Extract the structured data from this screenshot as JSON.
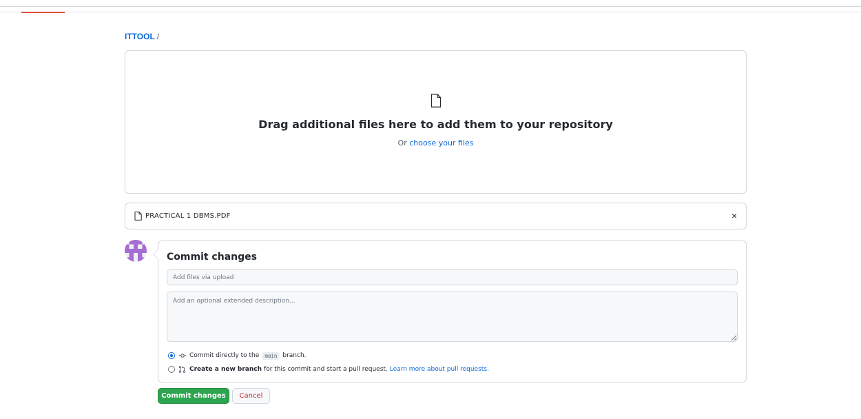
{
  "breadcrumb": {
    "repo": "ITTOOL",
    "separator": "/"
  },
  "dropzone": {
    "title": "Drag additional files here to add them to your repository",
    "sub_prefix": "Or",
    "sub_link": "choose your files",
    "icon": "file-icon"
  },
  "files": [
    {
      "name": "PRACTICAL 1 DBMS.PDF",
      "icon": "file-icon",
      "remove": "×"
    }
  ],
  "commit": {
    "title": "Commit changes",
    "summary_placeholder": "Add files via upload",
    "description_placeholder": "Add an optional extended description...",
    "option_direct": {
      "prefix": "Commit directly to the",
      "branch": "main",
      "suffix": "branch.",
      "selected": true
    },
    "option_new_branch": {
      "bold": "Create a new branch",
      "text": "for this commit and start a pull request.",
      "link": "Learn more about pull requests.",
      "selected": false
    },
    "submit_label": "Commit changes",
    "cancel_label": "Cancel"
  },
  "colors": {
    "link": "#0969da",
    "primary_button": "#2da44e",
    "danger_text": "#cf222e",
    "accent_bar": "#e0523a",
    "avatar": "#a66dd4"
  }
}
